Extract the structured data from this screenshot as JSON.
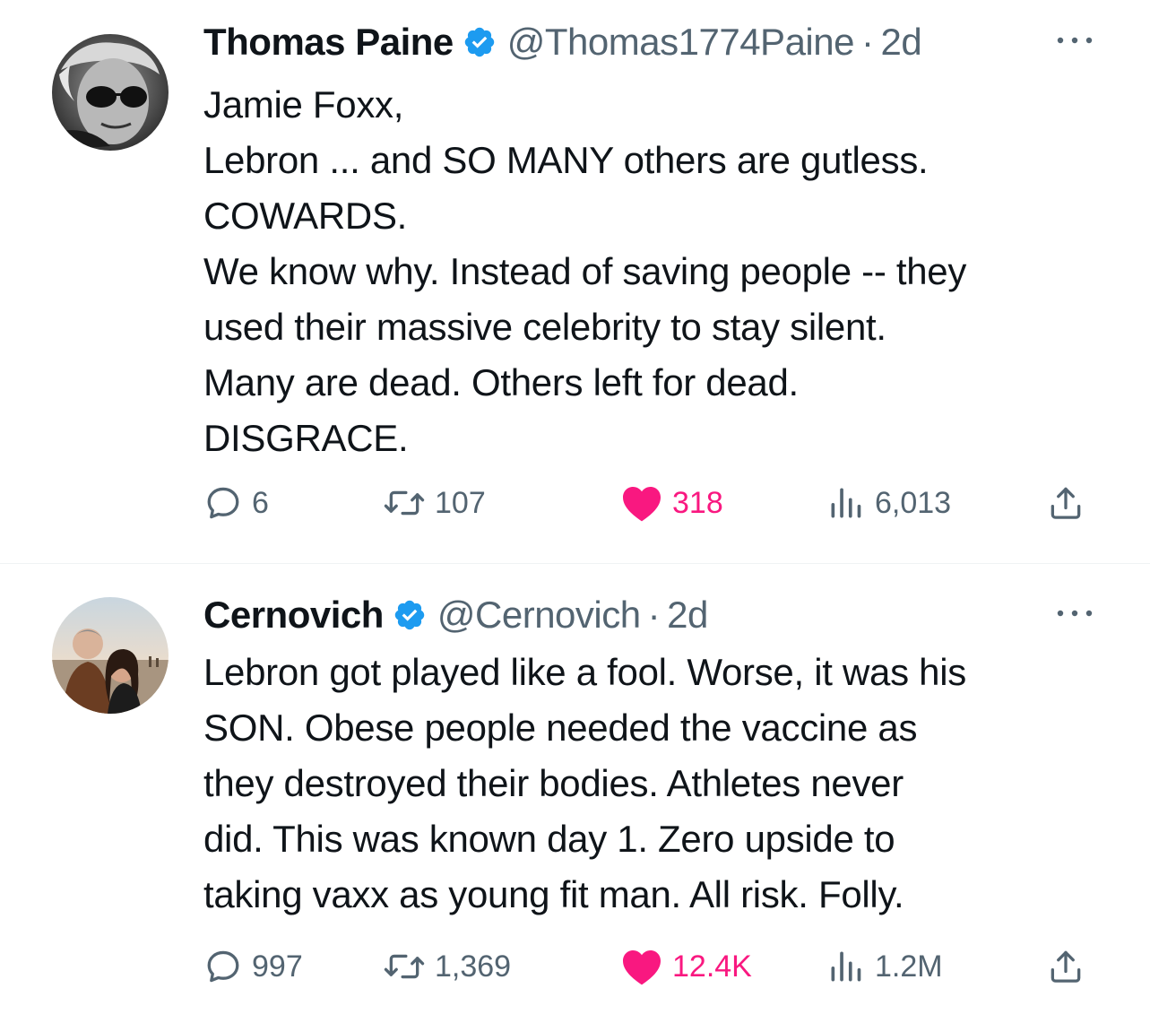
{
  "tweets": [
    {
      "author_name": "Thomas Paine",
      "handle": "@Thomas1774Paine",
      "separator": "·",
      "time": "2d",
      "text_lines": [
        "Jamie Foxx,",
        "Lebron ... and SO MANY others are gutless.",
        "COWARDS.",
        "We know why. Instead of saving people -- they",
        "used their massive celebrity to stay silent.",
        "Many are dead. Others left for dead.",
        "DISGRACE."
      ],
      "replies": "6",
      "retweets": "107",
      "likes": "318",
      "views": "6,013",
      "liked": true,
      "avatar_icon": "bw-portrait-sunglasses"
    },
    {
      "author_name": "Cernovich",
      "handle": "@Cernovich",
      "separator": "·",
      "time": "2d",
      "text_lines": [
        "Lebron got played like a fool. Worse, it was his",
        "SON. Obese people needed the vaccine as",
        "they destroyed their bodies. Athletes never",
        "did. This was known day 1. Zero upside to",
        "taking vaxx as young fit man. All risk. Folly."
      ],
      "replies": "997",
      "retweets": "1,369",
      "likes": "12.4K",
      "views": "1.2M",
      "liked": true,
      "avatar_icon": "couple-beach-photo"
    }
  ],
  "icons": {
    "reply": "reply-bubble-icon",
    "retweet": "retweet-arrows-icon",
    "like": "heart-icon",
    "views": "views-bar-chart-icon",
    "share": "share-upload-icon",
    "verified": "verified-badge-icon",
    "more": "more-dots-icon"
  },
  "colors": {
    "verified": "#1d9bf0",
    "like": "#f91880",
    "secondary_text": "#536471",
    "primary_text": "#0f1419",
    "divider": "#eff3f4"
  }
}
